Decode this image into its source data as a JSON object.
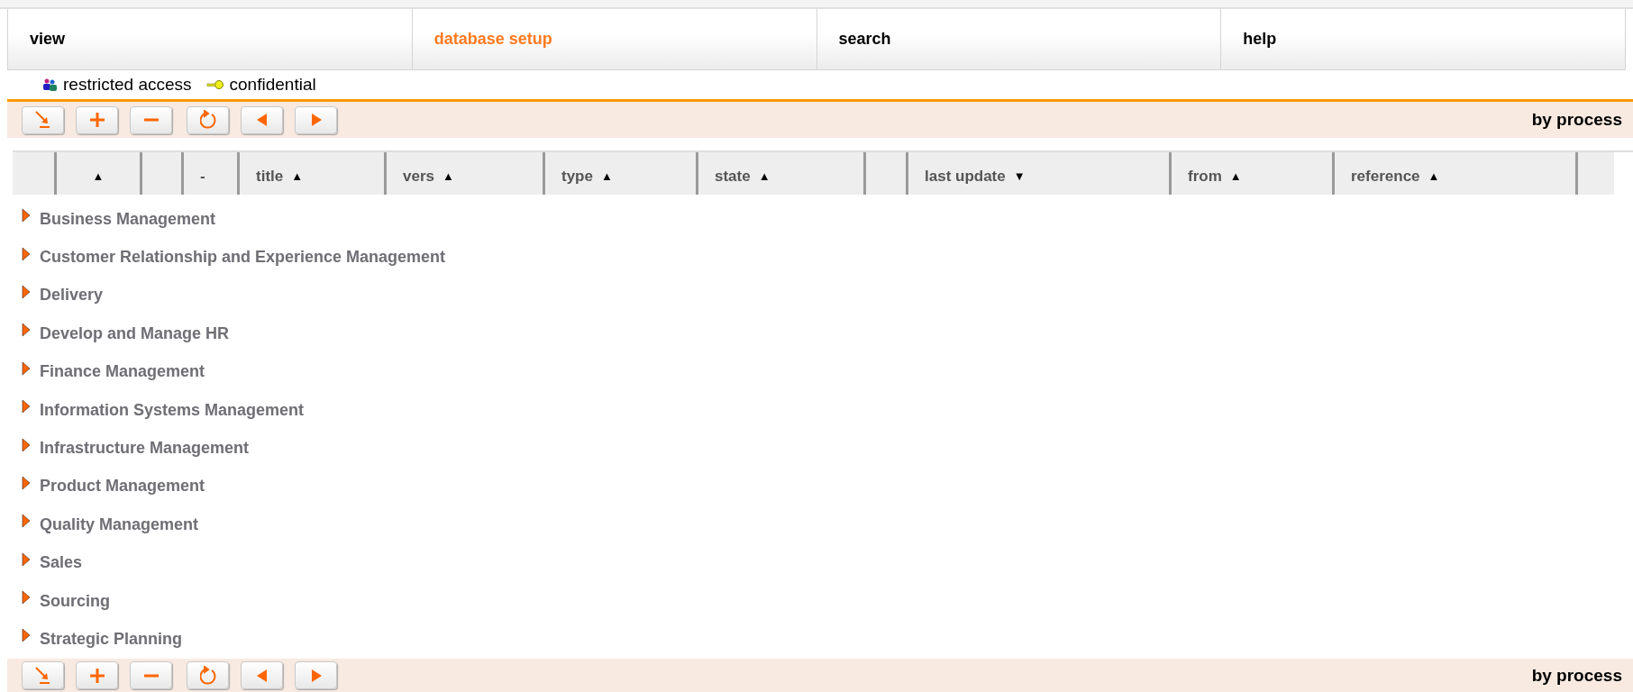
{
  "menu": [
    {
      "label": "view",
      "selected": false
    },
    {
      "label": "database setup",
      "selected": true
    },
    {
      "label": "search",
      "selected": false
    },
    {
      "label": "help",
      "selected": false
    }
  ],
  "legend": [
    {
      "kind": "people",
      "label": "restricted access"
    },
    {
      "kind": "key",
      "label": "confidential"
    }
  ],
  "toolbar_top": {
    "buttons": [
      {
        "kind": "import"
      },
      {
        "kind": "add"
      },
      {
        "kind": "remove"
      },
      {
        "kind": "refresh"
      },
      {
        "kind": "previous"
      },
      {
        "kind": "next"
      }
    ],
    "label": "by process"
  },
  "table": {
    "columns": [
      {},
      {
        "sort_arrow": "▲"
      },
      {},
      {
        "label": "-"
      },
      {
        "label": "title",
        "sort_arrow": "▲"
      },
      {
        "label": "vers",
        "sort_arrow": "▲"
      },
      {
        "label": "type",
        "sort_arrow": "▲"
      },
      {
        "label": "state",
        "sort_arrow": "▲"
      },
      {},
      {
        "label": "last update",
        "sort_arrow": "▼"
      },
      {
        "label": "from",
        "sort_arrow": "▲"
      },
      {
        "label": "reference",
        "sort_arrow": "▲"
      },
      {}
    ],
    "rows": [
      {
        "label": "Business Management",
        "expanded": false
      },
      {
        "label": "Customer Relationship and Experience Management",
        "expanded": false
      },
      {
        "label": "Delivery",
        "expanded": false
      },
      {
        "label": "Develop and Manage HR",
        "expanded": false
      },
      {
        "label": "Finance Management",
        "expanded": false
      },
      {
        "label": "Information Systems Management",
        "expanded": false
      },
      {
        "label": "Infrastructure Management",
        "expanded": false
      },
      {
        "label": "Product Management",
        "expanded": false
      },
      {
        "label": "Quality Management",
        "expanded": false
      },
      {
        "label": "Sales",
        "expanded": false
      },
      {
        "label": "Sourcing",
        "expanded": false
      },
      {
        "label": "Strategic Planning",
        "expanded": false
      }
    ]
  },
  "toolbar_bottom": {
    "buttons": [
      {
        "kind": "import"
      },
      {
        "kind": "add"
      },
      {
        "kind": "remove"
      },
      {
        "kind": "refresh"
      },
      {
        "kind": "previous"
      },
      {
        "kind": "next"
      }
    ],
    "label": "by process"
  }
}
